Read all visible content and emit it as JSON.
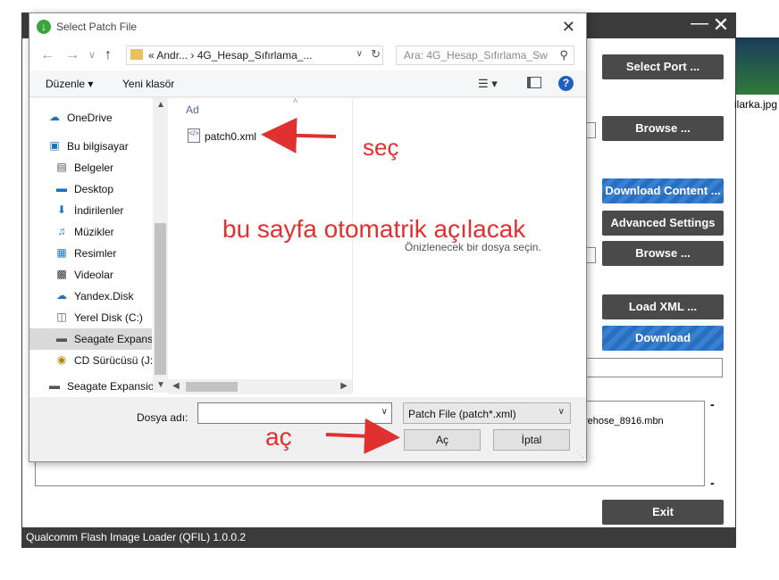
{
  "qfil": {
    "buttons": {
      "select_port": "Select Port ...",
      "browse1": "Browse ...",
      "download_content": "Download Content ...",
      "advanced_settings": "Advanced Settings",
      "browse2": "Browse ...",
      "load_xml": "Load XML ...",
      "download": "Download",
      "exit": "Exit"
    },
    "log_line": "rehose_8916.mbn",
    "status_bar": "Qualcomm Flash Image Loader (QFIL)   1.0.0.2",
    "colors": {
      "dark": "#3b3b3b",
      "accent_blue": "#2a6fbf"
    }
  },
  "desktop": {
    "file_label": "ilarka.jpg"
  },
  "dialog": {
    "title": "Select Patch File",
    "address": {
      "segments": "«  Andr...  ›  4G_Hesap_Sıfırlama_..."
    },
    "search_placeholder": "Ara: 4G_Hesap_Sıfırlama_Sw",
    "toolbar": {
      "organize": "Düzenle ▾",
      "new_folder": "Yeni klasör"
    },
    "nav_items": [
      {
        "label": "OneDrive",
        "icon": "cloud-icon"
      },
      {
        "label": "Bu bilgisayar",
        "icon": "computer-icon"
      },
      {
        "label": "Belgeler",
        "icon": "documents-icon"
      },
      {
        "label": "Desktop",
        "icon": "desktop-icon"
      },
      {
        "label": "İndirilenler",
        "icon": "download-icon"
      },
      {
        "label": "Müzikler",
        "icon": "music-icon"
      },
      {
        "label": "Resimler",
        "icon": "pictures-icon"
      },
      {
        "label": "Videolar",
        "icon": "videos-icon"
      },
      {
        "label": "Yandex.Disk",
        "icon": "cloud-icon"
      },
      {
        "label": "Yerel Disk (C:)",
        "icon": "drive-icon"
      },
      {
        "label": "Seagate Expansi",
        "icon": "drive-icon"
      },
      {
        "label": "CD Sürücüsü (J:)",
        "icon": "cd-icon"
      },
      {
        "label": "Seagate Expansio",
        "icon": "drive-icon"
      }
    ],
    "column_header": "Ad",
    "file": {
      "name": "patch0.xml"
    },
    "preview_text": "Önizlenecek bir dosya seçin.",
    "filename_label": "Dosya adı:",
    "filename_value": "",
    "filter": "Patch File (patch*.xml)",
    "open_label": "Aç",
    "cancel_label": "İptal"
  },
  "annotations": {
    "select": "seç",
    "auto_open": "bu sayfa otomatrik açılacak",
    "open": "aç",
    "color": "#e03030"
  }
}
